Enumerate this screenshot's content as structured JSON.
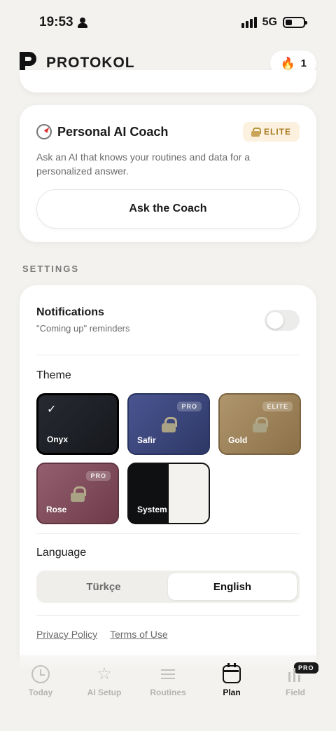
{
  "status_bar": {
    "time": "19:53",
    "network": "5G"
  },
  "header": {
    "brand": "PROTOKOL",
    "streak_count": "1"
  },
  "coach": {
    "title": "Personal AI Coach",
    "badge": "ELITE",
    "description": "Ask an AI that knows your routines and data for a personalized answer.",
    "button": "Ask the Coach"
  },
  "settings": {
    "section_label": "SETTINGS",
    "notifications": {
      "title": "Notifications",
      "subtitle": "\"Coming up\" reminders",
      "enabled": false
    },
    "theme": {
      "label": "Theme",
      "options": [
        {
          "name": "Onyx",
          "selected": true,
          "color": "#1f2127"
        },
        {
          "name": "Safir",
          "badge": "PRO",
          "locked": true,
          "color": "#3c4678"
        },
        {
          "name": "Gold",
          "badge": "ELITE",
          "locked": true,
          "color": "#9e835b"
        },
        {
          "name": "Rose",
          "badge": "PRO",
          "locked": true,
          "color": "#7f4c5b"
        },
        {
          "name": "System"
        }
      ]
    },
    "language": {
      "label": "Language",
      "options": [
        "Türkçe",
        "English"
      ],
      "selected": "English"
    },
    "links": {
      "privacy": "Privacy Policy",
      "terms": "Terms of Use"
    }
  },
  "tabs": [
    {
      "label": "Today",
      "icon": "clock-icon"
    },
    {
      "label": "AI Setup",
      "icon": "star-icon"
    },
    {
      "label": "Routines",
      "icon": "lines-icon"
    },
    {
      "label": "Plan",
      "icon": "calendar-icon",
      "active": true
    },
    {
      "label": "Field",
      "icon": "bars-icon",
      "badge": "PRO"
    }
  ]
}
